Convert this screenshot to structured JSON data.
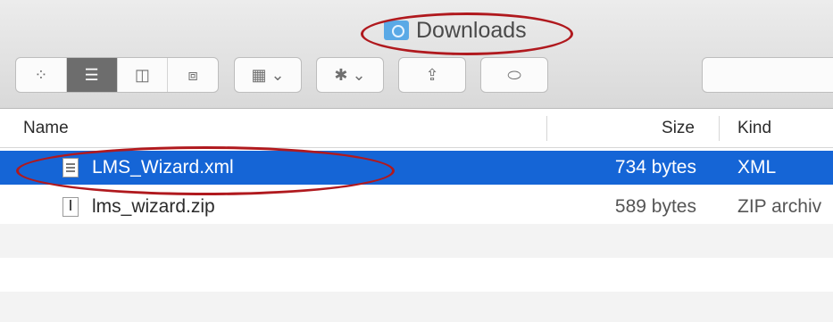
{
  "window": {
    "title": "Downloads"
  },
  "toolbar": {
    "view_buttons": [
      {
        "icon": "icon-view-icon",
        "glyph": "⁘"
      },
      {
        "icon": "list-view-icon",
        "glyph": "☰"
      },
      {
        "icon": "column-view-icon",
        "glyph": "◫"
      },
      {
        "icon": "cover-flow-view-icon",
        "glyph": "⧈"
      }
    ],
    "arrange": {
      "icon": "arrange-icon",
      "glyph": "▦ ⌄"
    },
    "action": {
      "icon": "gear-icon",
      "glyph": "✱ ⌄"
    },
    "share": {
      "icon": "share-icon",
      "glyph": "⇪"
    },
    "tags": {
      "icon": "tag-icon",
      "glyph": "⬭"
    }
  },
  "columns": {
    "name": "Name",
    "size": "Size",
    "kind": "Kind"
  },
  "files": [
    {
      "name": "LMS_Wizard.xml",
      "size": "734 bytes",
      "kind": "XML",
      "selected": true
    },
    {
      "name": "lms_wizard.zip",
      "size": "589 bytes",
      "kind": "ZIP archiv",
      "selected": false
    }
  ],
  "colors": {
    "selection": "#1565d6",
    "annotation": "#b0191e"
  }
}
